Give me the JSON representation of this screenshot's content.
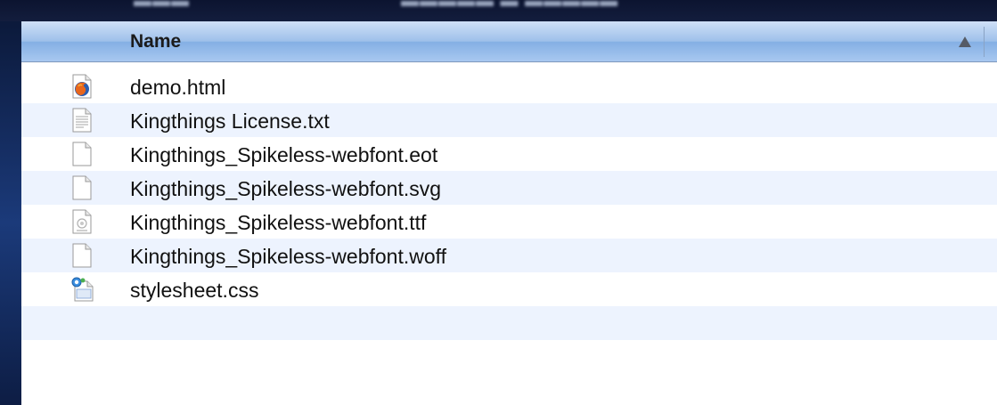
{
  "column_header": {
    "name_label": "Name",
    "sort_direction": "ascending"
  },
  "files": [
    {
      "name": "demo.html",
      "icon": "firefox-html-icon"
    },
    {
      "name": "Kingthings License.txt",
      "icon": "text-document-icon"
    },
    {
      "name": "Kingthings_Spikeless-webfont.eot",
      "icon": "blank-document-icon"
    },
    {
      "name": "Kingthings_Spikeless-webfont.svg",
      "icon": "blank-document-icon"
    },
    {
      "name": "Kingthings_Spikeless-webfont.ttf",
      "icon": "font-document-icon"
    },
    {
      "name": "Kingthings_Spikeless-webfont.woff",
      "icon": "blank-document-icon"
    },
    {
      "name": "stylesheet.css",
      "icon": "css-document-icon"
    }
  ],
  "colors": {
    "header_blue": "#9ec0ea",
    "alternate_row": "#edf3fe",
    "desktop_blue": "#1b3a7a"
  }
}
